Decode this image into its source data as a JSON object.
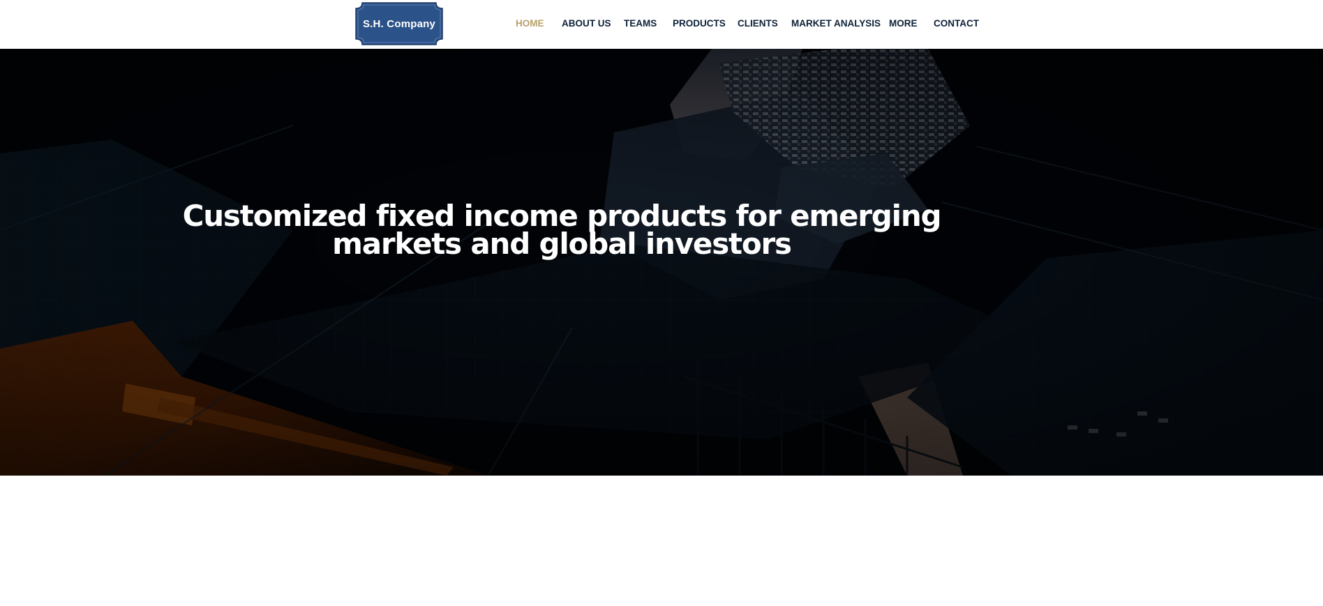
{
  "brand": {
    "logo_text": "S.H. Company",
    "logo_color": "#2b5289",
    "accent_color": "#b9a16b",
    "nav_text_color": "#0d2138"
  },
  "nav": {
    "items": [
      {
        "label": "HOME",
        "active": true
      },
      {
        "label": "ABOUT US",
        "active": false
      },
      {
        "label": "TEAMS",
        "active": false
      },
      {
        "label": "PRODUCTS",
        "active": false
      },
      {
        "label": "CLIENTS",
        "active": false
      },
      {
        "label": "MARKET ANALYSIS",
        "active": false
      },
      {
        "label": "MORE",
        "active": false
      },
      {
        "label": "CONTACT",
        "active": false
      }
    ]
  },
  "hero": {
    "title": "Customized fixed income products for emerging markets and global investors",
    "background": "dark city buildings looking up"
  }
}
